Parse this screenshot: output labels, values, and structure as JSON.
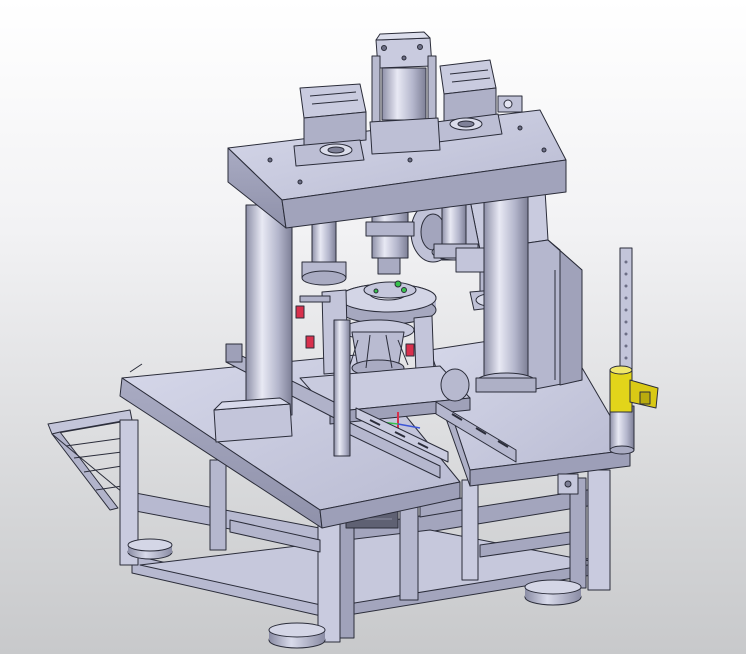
{
  "viewer": {
    "background": "gradient-white-to-grey",
    "model_color": "#c7c9df",
    "edge_color": "#2b2d3a",
    "accent_colors": {
      "clamp": "#e2d51a",
      "handle": "#d8304c",
      "marker": "#37c24c",
      "axis_blue": "#3b55d6"
    }
  },
  "model": {
    "description_icon": "cad-assembly-icon",
    "parts": [
      "press-top-plate",
      "cylinder",
      "left-slide-block",
      "right-slide-block",
      "left-column",
      "right-column",
      "rear-left-guide",
      "rear-right-guide",
      "fixture-assembly",
      "drive-motor-box",
      "vertical-scale-rod",
      "yellow-clamp",
      "main-table",
      "side-table",
      "frame-base",
      "side-tray",
      "leveling-feet"
    ]
  }
}
